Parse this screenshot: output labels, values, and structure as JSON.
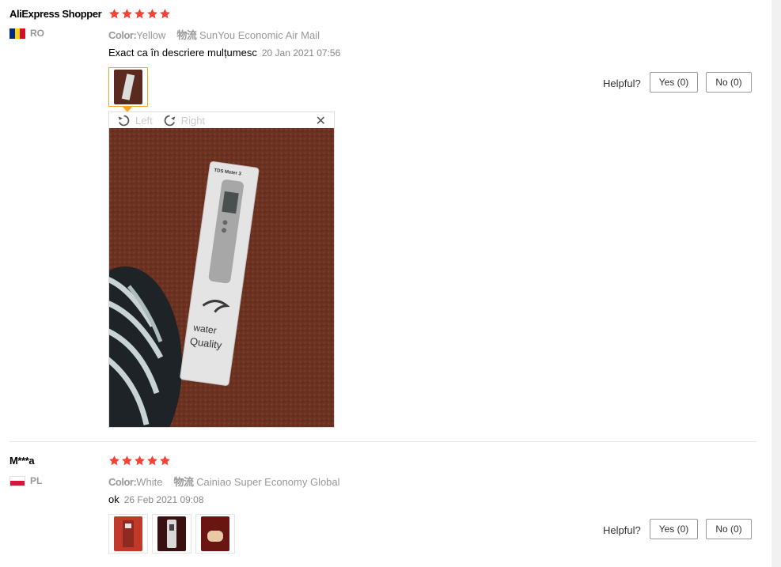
{
  "reviews": [
    {
      "user": "AliExpress Shopper",
      "country": "RO",
      "rating": 5,
      "color_label": "Color:",
      "color_value": "Yellow",
      "shipping_label": "物流",
      "shipping_value": "SunYou Economic Air Mail",
      "text": "Exact ca în descriere mulțumesc",
      "date": "20 Jan 2021 07:56",
      "helpful_label": "Helpful?",
      "yes_label": "Yes (0)",
      "no_label": "No (0)",
      "photo_viewer": {
        "rotate_left_label": "Left",
        "rotate_right_label": "Right",
        "close_glyph": "✕",
        "photo_text_line1": "water",
        "photo_text_line2": "Quality",
        "photo_box_label": "TDS Meter 3"
      }
    },
    {
      "user": "M***a",
      "country": "PL",
      "rating": 5,
      "color_label": "Color:",
      "color_value": "White",
      "shipping_label": "物流",
      "shipping_value": "Cainiao Super Economy Global",
      "text": "ok",
      "date": "26 Feb 2021 09:08",
      "helpful_label": "Helpful?",
      "yes_label": "Yes (0)",
      "no_label": "No (0)"
    }
  ],
  "colors": {
    "star": "#f44336",
    "thumb_selected_border": "#f5a623",
    "flag_ro": [
      "#002b7f",
      "#fcd116",
      "#ce1126"
    ],
    "flag_pl": [
      "#ffffff",
      "#dc143c"
    ]
  },
  "icons": {
    "star": "star-icon",
    "rotate_left": "rotate-left-icon",
    "rotate_right": "rotate-right-icon",
    "close": "close-icon"
  }
}
